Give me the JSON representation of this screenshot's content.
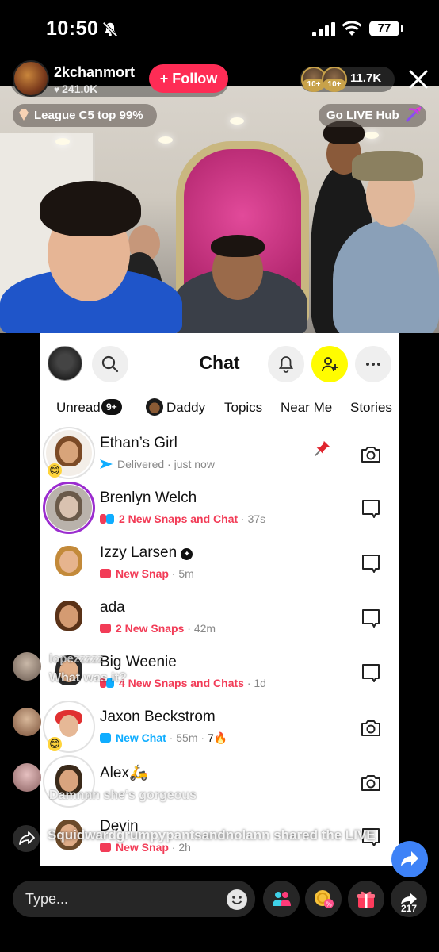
{
  "status_bar": {
    "time": "10:50",
    "battery": "77"
  },
  "live": {
    "host_name": "2kchanmort",
    "host_likes": "241.0K",
    "follow_label": "+ Follow",
    "viewer_badge_1": "10+",
    "viewer_badge_2": "10+",
    "viewer_count": "11.7K",
    "rank_label": "League C5 top 99%",
    "hub_label": "Go LIVE Hub"
  },
  "snapchat": {
    "title": "Chat",
    "filters": {
      "unread": "Unread",
      "unread_count": "9+",
      "daddy": "Daddy",
      "topics": "Topics",
      "near_me": "Near Me",
      "stories": "Stories"
    },
    "chats": [
      {
        "name": "Ethan’s Girl",
        "status": "Delivered",
        "time": "just now",
        "status_style": "gray",
        "icon_color": "#0fadff",
        "action": "camera",
        "pinned": true
      },
      {
        "name": "Brenlyn Welch",
        "status": "2 New Snaps and Chat",
        "time": "37s",
        "status_style": "red",
        "icon_color": "#f23c57",
        "action": "chat"
      },
      {
        "name": "Izzy Larsen",
        "status": "New Snap",
        "time": "5m",
        "status_style": "red",
        "icon_color": "#f23c57",
        "action": "chat"
      },
      {
        "name": "ada",
        "status": "2 New Snaps",
        "time": "42m",
        "status_style": "red",
        "icon_color": "#f23c57",
        "action": "chat"
      },
      {
        "name": "Big Weenie",
        "status": "4 New Snaps and Chats",
        "time": "1d",
        "status_style": "red",
        "icon_color": "#f23c57",
        "action": "chat"
      },
      {
        "name": "Jaxon Beckstrom",
        "status": "New Chat",
        "time": "55m",
        "extra": "7🔥",
        "status_style": "blue",
        "icon_color": "#0fadff",
        "action": "camera"
      },
      {
        "name": "Alex🛵",
        "status": "",
        "time": "",
        "status_style": "gray",
        "icon_color": "#888",
        "action": "camera"
      },
      {
        "name": "Devin",
        "status": "New Snap",
        "time": "2h",
        "status_style": "red",
        "icon_color": "#f23c57",
        "action": "chat"
      }
    ]
  },
  "comments": [
    {
      "name": "lopezzzzz",
      "text": "What was it?"
    },
    {
      "name": "",
      "text": "Damnnn she's gorgeous"
    }
  ],
  "share_notice": "Squidwardgrumpypantsandnolann shared the LIVE",
  "bottom": {
    "input_placeholder": "Type...",
    "share_count": "217"
  }
}
